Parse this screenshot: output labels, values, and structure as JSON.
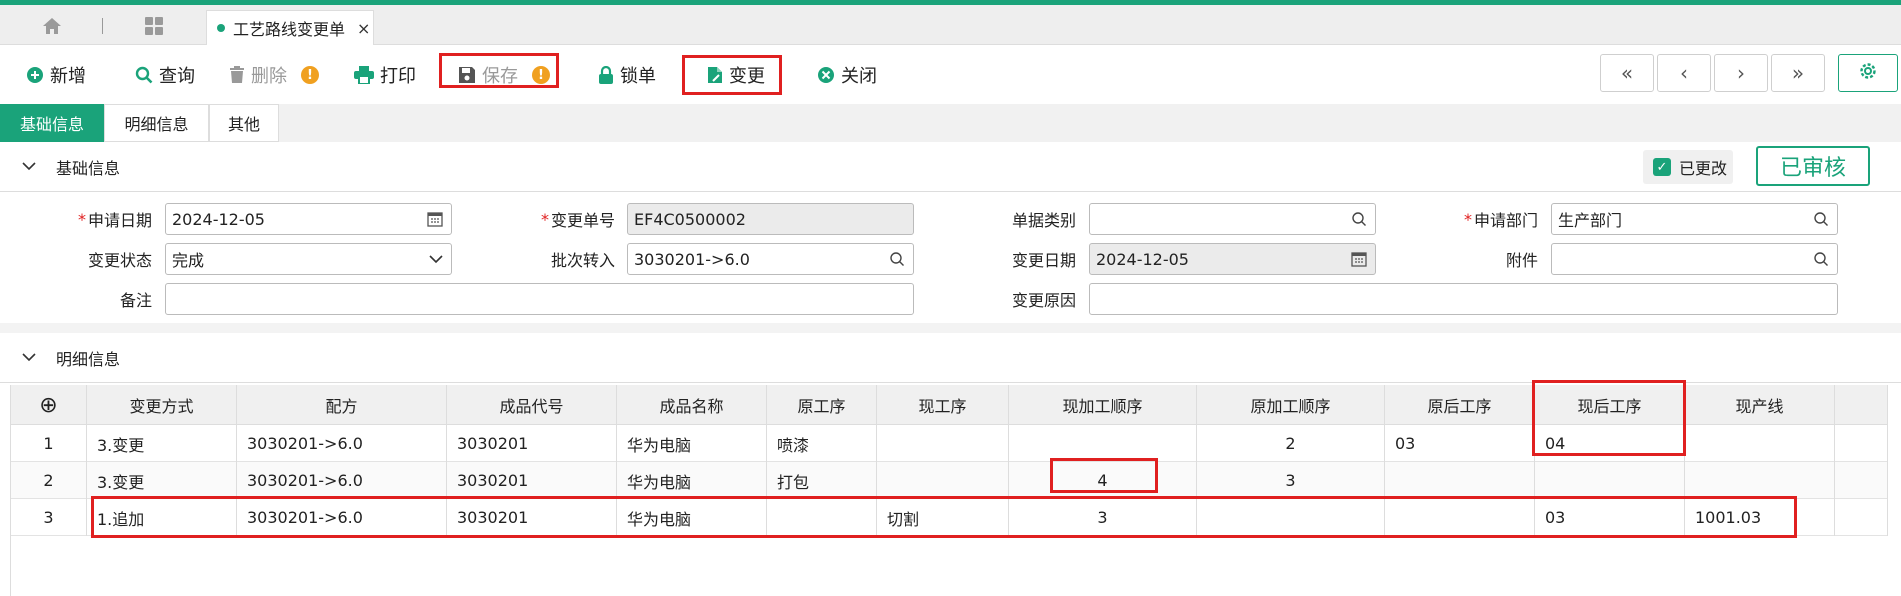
{
  "tabs": {
    "active_label": "工艺路线变更单",
    "close": "×"
  },
  "toolbar": {
    "add": "新增",
    "query": "查询",
    "delete": "删除",
    "print": "打印",
    "save": "保存",
    "lock": "锁单",
    "change": "变更",
    "close": "关闭",
    "warn": "!"
  },
  "nav": {
    "first": "«",
    "prev": "‹",
    "next": "›",
    "last": "»"
  },
  "subtabs": [
    "基础信息",
    "明细信息",
    "其他"
  ],
  "basic": {
    "title": "基础信息",
    "modified_label": "已更改",
    "approved_label": "已审核",
    "apply_date_label": "申请日期",
    "apply_date": "2024-12-05",
    "change_no_label": "变更单号",
    "change_no": "EF4C0500002",
    "doc_type_label": "单据类别",
    "doc_type": "",
    "apply_dept_label": "申请部门",
    "apply_dept": "生产部门",
    "status_label": "变更状态",
    "status": "完成",
    "batch_label": "批次转入",
    "batch": "3030201->6.0",
    "change_date_label": "变更日期",
    "change_date": "2024-12-05",
    "attach_label": "附件",
    "attach": "",
    "remark_label": "备注",
    "remark": "",
    "reason_label": "变更原因",
    "reason": ""
  },
  "detail": {
    "title": "明细信息",
    "columns": [
      "⊕",
      "变更方式",
      "配方",
      "成品代号",
      "成品名称",
      "原工序",
      "现工序",
      "现加工顺序",
      "原加工顺序",
      "原后工序",
      "现后工序",
      "现产线"
    ],
    "rows": [
      [
        "1",
        "3.变更",
        "3030201->6.0",
        "3030201",
        "华为电脑",
        "喷漆",
        "",
        "",
        "2",
        "03",
        "04",
        ""
      ],
      [
        "2",
        "3.变更",
        "3030201->6.0",
        "3030201",
        "华为电脑",
        "打包",
        "",
        "4",
        "3",
        "",
        "",
        ""
      ],
      [
        "3",
        "1.追加",
        "3030201->6.0",
        "3030201",
        "华为电脑",
        "",
        "切割",
        "3",
        "",
        "",
        "03",
        "1001.03"
      ]
    ]
  },
  "colors": {
    "accent": "#1aa37a",
    "highlight": "#e02020",
    "warning": "#f0a020"
  }
}
